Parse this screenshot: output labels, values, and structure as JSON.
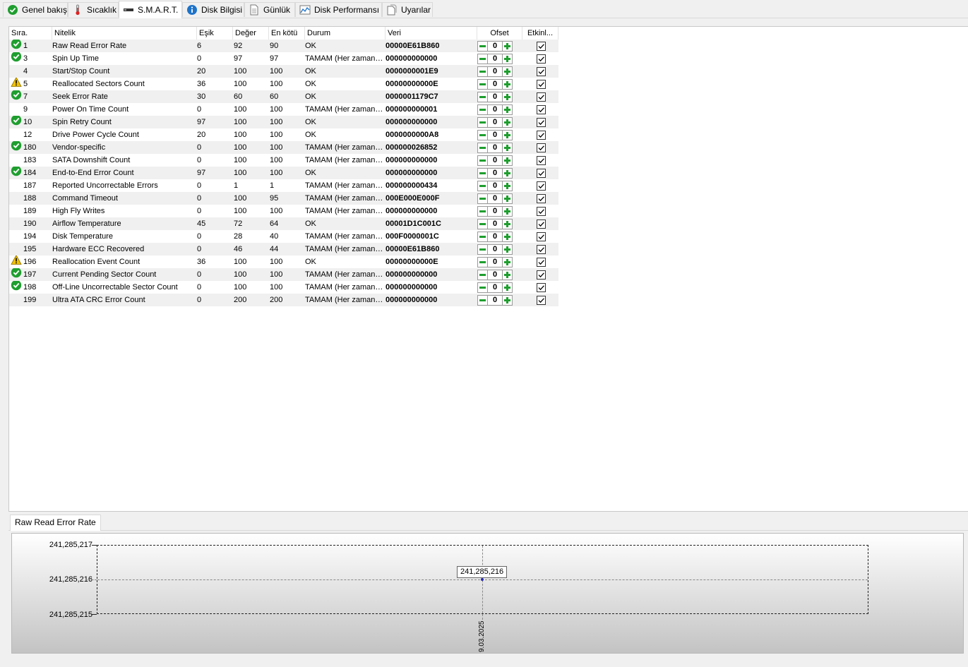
{
  "tabs": [
    {
      "label": "Genel bakış",
      "icon": "check-circle-icon",
      "active": false
    },
    {
      "label": "Sıcaklık",
      "icon": "thermometer-icon",
      "active": false
    },
    {
      "label": "S.M.A.R.T.",
      "icon": "drive-icon",
      "active": true
    },
    {
      "label": "Disk Bilgisi",
      "icon": "info-icon",
      "active": false
    },
    {
      "label": "Günlük",
      "icon": "document-icon",
      "active": false
    },
    {
      "label": "Disk Performansı",
      "icon": "chart-icon",
      "active": false
    },
    {
      "label": "Uyarılar",
      "icon": "alerts-icon",
      "active": false
    }
  ],
  "columns": {
    "id": "Sıra.",
    "name": "Nitelik",
    "threshold": "Eşik",
    "value": "Değer",
    "worst": "En kötü",
    "status": "Durum",
    "raw": "Veri",
    "offset": "Ofset",
    "enabled": "Etkinl..."
  },
  "rows": [
    {
      "icon": "ok",
      "id": "1",
      "name": "Raw Read Error Rate",
      "threshold": "6",
      "value": "92",
      "worst": "90",
      "status": "OK",
      "raw": "00000E61B860",
      "offset": "0",
      "enabled": true
    },
    {
      "icon": "ok",
      "id": "3",
      "name": "Spin Up Time",
      "threshold": "0",
      "value": "97",
      "worst": "97",
      "status": "TAMAM (Her zaman geçti)",
      "raw": "000000000000",
      "offset": "0",
      "enabled": true
    },
    {
      "icon": "",
      "id": "4",
      "name": "Start/Stop Count",
      "threshold": "20",
      "value": "100",
      "worst": "100",
      "status": "OK",
      "raw": "0000000001E9",
      "offset": "0",
      "enabled": true
    },
    {
      "icon": "warn",
      "id": "5",
      "name": "Reallocated Sectors Count",
      "threshold": "36",
      "value": "100",
      "worst": "100",
      "status": "OK",
      "raw": "00000000000E",
      "offset": "0",
      "enabled": true
    },
    {
      "icon": "ok",
      "id": "7",
      "name": "Seek Error Rate",
      "threshold": "30",
      "value": "60",
      "worst": "60",
      "status": "OK",
      "raw": "0000001179C7",
      "offset": "0",
      "enabled": true
    },
    {
      "icon": "",
      "id": "9",
      "name": "Power On Time Count",
      "threshold": "0",
      "value": "100",
      "worst": "100",
      "status": "TAMAM (Her zaman geçti)",
      "raw": "000000000001",
      "offset": "0",
      "enabled": true
    },
    {
      "icon": "ok",
      "id": "10",
      "name": "Spin Retry Count",
      "threshold": "97",
      "value": "100",
      "worst": "100",
      "status": "OK",
      "raw": "000000000000",
      "offset": "0",
      "enabled": true
    },
    {
      "icon": "",
      "id": "12",
      "name": "Drive Power Cycle Count",
      "threshold": "20",
      "value": "100",
      "worst": "100",
      "status": "OK",
      "raw": "0000000000A8",
      "offset": "0",
      "enabled": true
    },
    {
      "icon": "ok",
      "id": "180",
      "name": "Vendor-specific",
      "threshold": "0",
      "value": "100",
      "worst": "100",
      "status": "TAMAM (Her zaman geçti)",
      "raw": "000000026852",
      "offset": "0",
      "enabled": true
    },
    {
      "icon": "",
      "id": "183",
      "name": "SATA Downshift Count",
      "threshold": "0",
      "value": "100",
      "worst": "100",
      "status": "TAMAM (Her zaman geçti)",
      "raw": "000000000000",
      "offset": "0",
      "enabled": true
    },
    {
      "icon": "ok",
      "id": "184",
      "name": "End-to-End Error Count",
      "threshold": "97",
      "value": "100",
      "worst": "100",
      "status": "OK",
      "raw": "000000000000",
      "offset": "0",
      "enabled": true
    },
    {
      "icon": "",
      "id": "187",
      "name": "Reported Uncorrectable Errors",
      "threshold": "0",
      "value": "1",
      "worst": "1",
      "status": "TAMAM (Her zaman geçti)",
      "raw": "000000000434",
      "offset": "0",
      "enabled": true
    },
    {
      "icon": "",
      "id": "188",
      "name": "Command Timeout",
      "threshold": "0",
      "value": "100",
      "worst": "95",
      "status": "TAMAM (Her zaman geçti)",
      "raw": "000E000E000F",
      "offset": "0",
      "enabled": true
    },
    {
      "icon": "",
      "id": "189",
      "name": "High Fly Writes",
      "threshold": "0",
      "value": "100",
      "worst": "100",
      "status": "TAMAM (Her zaman geçti)",
      "raw": "000000000000",
      "offset": "0",
      "enabled": true
    },
    {
      "icon": "",
      "id": "190",
      "name": "Airflow Temperature",
      "threshold": "45",
      "value": "72",
      "worst": "64",
      "status": "OK",
      "raw": "00001D1C001C",
      "offset": "0",
      "enabled": true
    },
    {
      "icon": "",
      "id": "194",
      "name": "Disk Temperature",
      "threshold": "0",
      "value": "28",
      "worst": "40",
      "status": "TAMAM (Her zaman geçti)",
      "raw": "000F0000001C",
      "offset": "0",
      "enabled": true
    },
    {
      "icon": "",
      "id": "195",
      "name": "Hardware ECC Recovered",
      "threshold": "0",
      "value": "46",
      "worst": "44",
      "status": "TAMAM (Her zaman geçti)",
      "raw": "00000E61B860",
      "offset": "0",
      "enabled": true
    },
    {
      "icon": "warn",
      "id": "196",
      "name": "Reallocation Event Count",
      "threshold": "36",
      "value": "100",
      "worst": "100",
      "status": "OK",
      "raw": "00000000000E",
      "offset": "0",
      "enabled": true
    },
    {
      "icon": "ok",
      "id": "197",
      "name": "Current Pending Sector Count",
      "threshold": "0",
      "value": "100",
      "worst": "100",
      "status": "TAMAM (Her zaman geçti)",
      "raw": "000000000000",
      "offset": "0",
      "enabled": true
    },
    {
      "icon": "ok",
      "id": "198",
      "name": "Off-Line Uncorrectable Sector Count",
      "threshold": "0",
      "value": "100",
      "worst": "100",
      "status": "TAMAM (Her zaman geçti)",
      "raw": "000000000000",
      "offset": "0",
      "enabled": true
    },
    {
      "icon": "",
      "id": "199",
      "name": "Ultra ATA CRC Error Count",
      "threshold": "0",
      "value": "200",
      "worst": "200",
      "status": "TAMAM (Her zaman geçti)",
      "raw": "000000000000",
      "offset": "0",
      "enabled": true
    }
  ],
  "graph": {
    "tab_label": "Raw Read Error Rate",
    "y_ticks": [
      "241,285,217",
      "241,285,216",
      "241,285,215"
    ],
    "point_label": "241,285,216",
    "x_date": "9.03.2025"
  },
  "colors": {
    "ok_green": "#1f9e2f",
    "warn_yellow": "#f2c200",
    "row_alt": "#f0f0f0"
  },
  "chart_data": {
    "type": "line",
    "title": "Raw Read Error Rate",
    "x": [
      "9.03.2025"
    ],
    "series": [
      {
        "values": [
          241285216
        ]
      }
    ],
    "ylim": [
      241285215,
      241285217
    ],
    "yticks": [
      "241,285,217",
      "241,285,216",
      "241,285,215"
    ],
    "grid": true
  }
}
